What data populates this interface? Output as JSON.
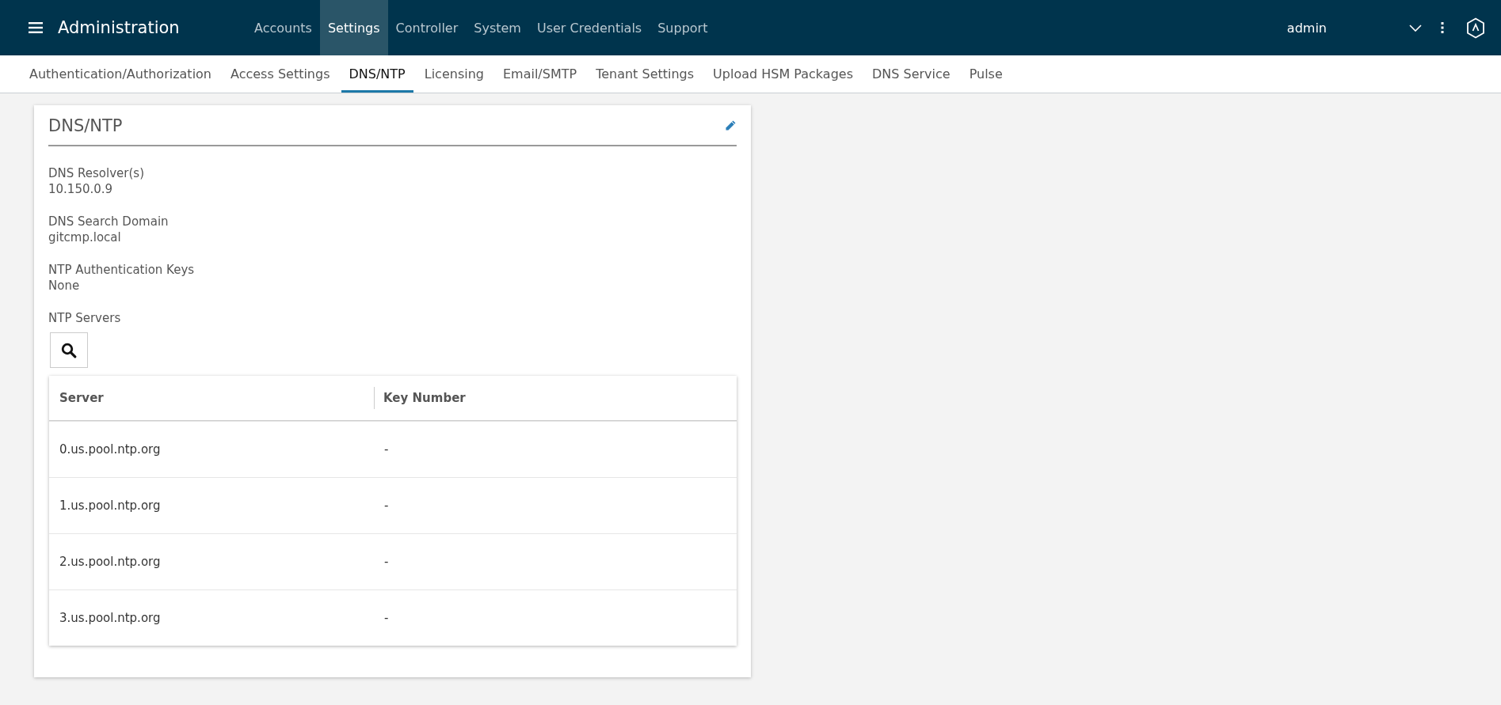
{
  "header": {
    "title": "Administration",
    "nav": [
      {
        "label": "Accounts",
        "selected": false
      },
      {
        "label": "Settings",
        "selected": true
      },
      {
        "label": "Controller",
        "selected": false
      },
      {
        "label": "System",
        "selected": false
      },
      {
        "label": "User Credentials",
        "selected": false
      },
      {
        "label": "Support",
        "selected": false
      }
    ],
    "user": "admin"
  },
  "tabs": [
    {
      "label": "Authentication/Authorization",
      "selected": false
    },
    {
      "label": "Access Settings",
      "selected": false
    },
    {
      "label": "DNS/NTP",
      "selected": true
    },
    {
      "label": "Licensing",
      "selected": false
    },
    {
      "label": "Email/SMTP",
      "selected": false
    },
    {
      "label": "Tenant Settings",
      "selected": false
    },
    {
      "label": "Upload HSM Packages",
      "selected": false
    },
    {
      "label": "DNS Service",
      "selected": false
    },
    {
      "label": "Pulse",
      "selected": false
    }
  ],
  "card": {
    "title": "DNS/NTP",
    "fields": [
      {
        "label": "DNS Resolver(s)",
        "value": "10.150.0.9"
      },
      {
        "label": "DNS Search Domain",
        "value": "gitcmp.local"
      },
      {
        "label": "NTP Authentication Keys",
        "value": "None"
      }
    ],
    "servers_label": "NTP Servers",
    "table": {
      "columns": [
        "Server",
        "Key Number"
      ],
      "rows": [
        [
          "0.us.pool.ntp.org",
          "-"
        ],
        [
          "1.us.pool.ntp.org",
          "-"
        ],
        [
          "2.us.pool.ntp.org",
          "-"
        ],
        [
          "3.us.pool.ntp.org",
          "-"
        ]
      ]
    }
  }
}
